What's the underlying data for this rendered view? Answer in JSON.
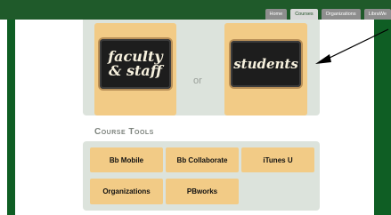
{
  "nav": {
    "tabs": [
      {
        "label": "Home",
        "active": false
      },
      {
        "label": "Courses",
        "active": true
      },
      {
        "label": "Organizations",
        "active": false
      },
      {
        "label": "LibraWe",
        "active": false
      }
    ]
  },
  "role_select": {
    "faculty_line1": "faculty",
    "faculty_line2": "& staff",
    "separator": "or",
    "students": "students"
  },
  "course_tools": {
    "title": "Course Tools",
    "items": [
      "Bb Mobile",
      "Bb Collaborate",
      "iTunes U",
      "Organizations",
      "PBworks"
    ]
  },
  "colors": {
    "header_green": "#1f5a2a",
    "tile_gold": "#f2cb86",
    "panel_gray": "#dce3dc",
    "chalkboard": "#1d1d1d"
  }
}
